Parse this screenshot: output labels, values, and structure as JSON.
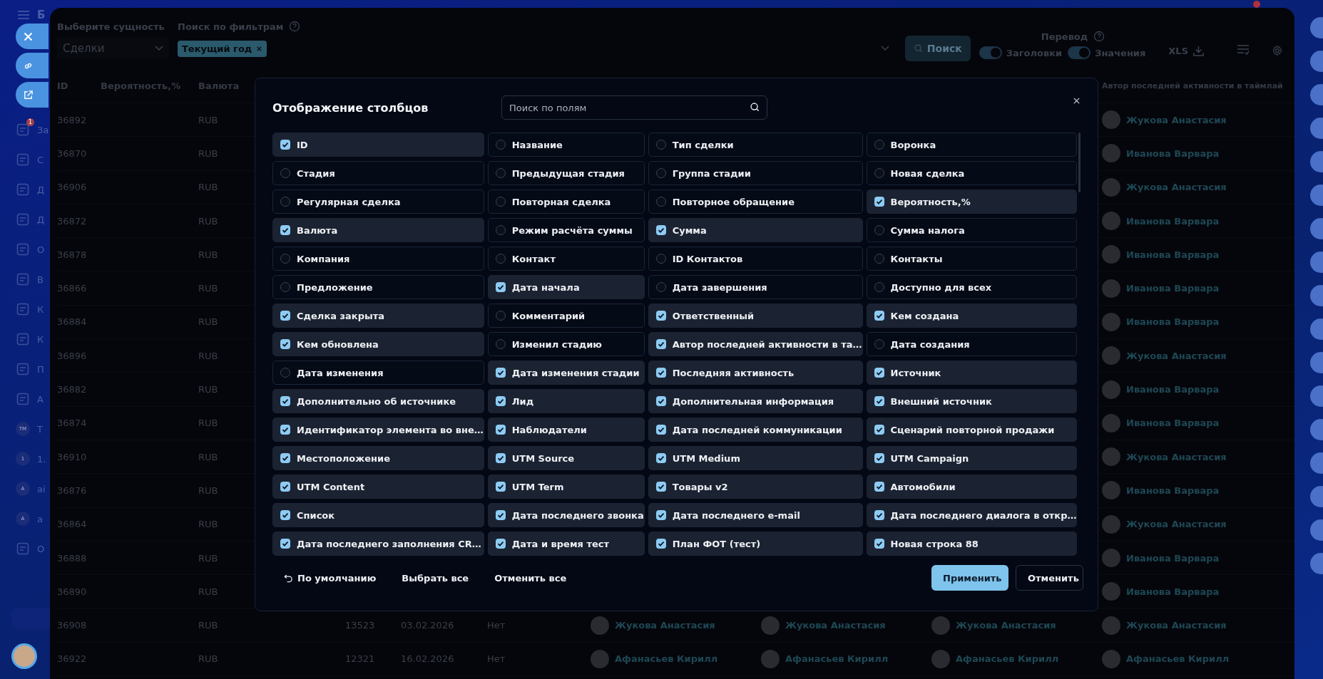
{
  "sidebar": {
    "brand": "Б",
    "items": [
      {
        "kind": "icon",
        "label": "За",
        "badge": "1"
      },
      {
        "kind": "icon",
        "label": "С"
      },
      {
        "kind": "icon",
        "label": "Д"
      },
      {
        "kind": "icon",
        "label": "Д"
      },
      {
        "kind": "icon",
        "label": "О"
      },
      {
        "kind": "icon",
        "label": "В"
      },
      {
        "kind": "icon",
        "label": "К"
      },
      {
        "kind": "icon",
        "label": "К"
      },
      {
        "kind": "icon",
        "label": "П"
      },
      {
        "kind": "icon",
        "label": "А"
      },
      {
        "kind": "circle",
        "initials": "ТМ",
        "label": "Т"
      },
      {
        "kind": "circle",
        "initials": "1",
        "label": "1."
      },
      {
        "kind": "circle",
        "initials": "A",
        "label": "ai"
      },
      {
        "kind": "circle",
        "initials": "A",
        "label": "a"
      },
      {
        "kind": "icon",
        "label": "О"
      }
    ]
  },
  "toolbar": {
    "entity_label": "Выберите сущность",
    "entity_value": "Сделки",
    "filter_label": "Поиск по фильтрам",
    "filter_chips": [
      "Текущий год"
    ],
    "search_button": "Поиск",
    "translation_label": "Перевод",
    "toggles": [
      {
        "label": "Заголовки",
        "on": true
      },
      {
        "label": "Значения",
        "on": true
      }
    ],
    "export_button": "XLS"
  },
  "table": {
    "columns": [
      "ID",
      "Вероятность,%",
      "Валюта",
      "Автор последней активности в таймлай"
    ],
    "rows": [
      {
        "id": "36892",
        "currency": "RUB",
        "author": "Жукова Анастасия"
      },
      {
        "id": "36870",
        "currency": "RUB",
        "author": "Иванова Варвара"
      },
      {
        "id": "36906",
        "currency": "RUB",
        "author": "Жукова Анастасия"
      },
      {
        "id": "36872",
        "currency": "RUB",
        "author": "Иванова Варвара"
      },
      {
        "id": "36878",
        "currency": "RUB",
        "author": "Иванова Варвара"
      },
      {
        "id": "36866",
        "currency": "RUB",
        "author": "Иванова Варвара"
      },
      {
        "id": "36884",
        "currency": "RUB",
        "author": "Иванова Варвара"
      },
      {
        "id": "36896",
        "currency": "RUB",
        "author": "Жукова Анастасия"
      },
      {
        "id": "36882",
        "currency": "RUB",
        "author": "Иванова Варвара"
      },
      {
        "id": "36874",
        "currency": "RUB",
        "author": "Иванова Варвара"
      },
      {
        "id": "36910",
        "currency": "RUB",
        "author": "Жукова Анастасия"
      },
      {
        "id": "36876",
        "currency": "RUB",
        "author": "Иванова Варвара"
      },
      {
        "id": "36864",
        "currency": "RUB",
        "author": "Жукова Анастасия"
      },
      {
        "id": "36888",
        "currency": "RUB",
        "author": "Иванова Варвара"
      },
      {
        "id": "36890",
        "currency": "RUB",
        "author": "Иванова Варвара"
      },
      {
        "id": "36908",
        "currency": "RUB",
        "column_4": "13523",
        "column_5": "03.02.2026",
        "column_6": "Нет",
        "column_7": "Жукова Анастасия",
        "column_8": "Жукова Анастасия",
        "column_9": "Жукова Анастасия",
        "author": "Жукова Анастасия"
      },
      {
        "id": "36922",
        "currency": "RUB",
        "column_4": "12321",
        "column_5": "16.02.2026",
        "column_6": "Нет",
        "column_7": "Афанасьев Кирилл",
        "column_8": "Афанасьев Кирилл",
        "column_9": "Афанасьев Кирилл",
        "author": "Афанасьев Кирилл"
      }
    ]
  },
  "modal": {
    "title": "Отображение столбцов",
    "search_placeholder": "Поиск по полям",
    "fields": [
      {
        "label": "ID",
        "checked": true
      },
      {
        "label": "Название",
        "checked": false
      },
      {
        "label": "Тип сделки",
        "checked": false
      },
      {
        "label": "Воронка",
        "checked": false
      },
      {
        "label": "Стадия",
        "checked": false
      },
      {
        "label": "Предыдущая стадия",
        "checked": false
      },
      {
        "label": "Группа стадии",
        "checked": false
      },
      {
        "label": "Новая сделка",
        "checked": false
      },
      {
        "label": "Регулярная сделка",
        "checked": false
      },
      {
        "label": "Повторная сделка",
        "checked": false
      },
      {
        "label": "Повторное обращение",
        "checked": false
      },
      {
        "label": "Вероятность,%",
        "checked": true
      },
      {
        "label": "Валюта",
        "checked": true
      },
      {
        "label": "Режим расчёта суммы",
        "checked": false
      },
      {
        "label": "Сумма",
        "checked": true
      },
      {
        "label": "Сумма налога",
        "checked": false
      },
      {
        "label": "Компания",
        "checked": false
      },
      {
        "label": "Контакт",
        "checked": false
      },
      {
        "label": "ID Контактов",
        "checked": false
      },
      {
        "label": "Контакты",
        "checked": false
      },
      {
        "label": "Предложение",
        "checked": false
      },
      {
        "label": "Дата начала",
        "checked": true
      },
      {
        "label": "Дата завершения",
        "checked": false
      },
      {
        "label": "Доступно для всех",
        "checked": false
      },
      {
        "label": "Сделка закрыта",
        "checked": true
      },
      {
        "label": "Комментарий",
        "checked": false
      },
      {
        "label": "Ответственный",
        "checked": true
      },
      {
        "label": "Кем создана",
        "checked": true
      },
      {
        "label": "Кем обновлена",
        "checked": true
      },
      {
        "label": "Изменил стадию",
        "checked": false
      },
      {
        "label": "Автор последней активности в та…",
        "checked": true
      },
      {
        "label": "Дата создания",
        "checked": false
      },
      {
        "label": "Дата изменения",
        "checked": false
      },
      {
        "label": "Дата изменения стадии",
        "checked": true
      },
      {
        "label": "Последняя активность",
        "checked": true
      },
      {
        "label": "Источник",
        "checked": true
      },
      {
        "label": "Дополнительно об источнике",
        "checked": true
      },
      {
        "label": "Лид",
        "checked": true
      },
      {
        "label": "Дополнительная информация",
        "checked": true
      },
      {
        "label": "Внешний источник",
        "checked": true
      },
      {
        "label": "Идентификатор элемента во вне…",
        "checked": true
      },
      {
        "label": "Наблюдатели",
        "checked": true
      },
      {
        "label": "Дата последней коммуникации",
        "checked": true
      },
      {
        "label": "Сценарий повторной продажи",
        "checked": true
      },
      {
        "label": "Местоположение",
        "checked": true
      },
      {
        "label": "UTM Source",
        "checked": true
      },
      {
        "label": "UTM Medium",
        "checked": true
      },
      {
        "label": "UTM Campaign",
        "checked": true
      },
      {
        "label": "UTM Content",
        "checked": true
      },
      {
        "label": "UTM Term",
        "checked": true
      },
      {
        "label": "Товары v2",
        "checked": true
      },
      {
        "label": "Автомобили",
        "checked": true
      },
      {
        "label": "Список",
        "checked": true
      },
      {
        "label": "Дата последнего звонка",
        "checked": true
      },
      {
        "label": "Дата последнего e-mail",
        "checked": true
      },
      {
        "label": "Дата последнего диалога в откр…",
        "checked": true
      },
      {
        "label": "Дата последнего заполнения CR…",
        "checked": true
      },
      {
        "label": "Дата и время тест",
        "checked": true
      },
      {
        "label": "План ФОТ (тест)",
        "checked": true
      },
      {
        "label": "Новая строка 88",
        "checked": true
      }
    ],
    "footer_links": [
      "По умолчанию",
      "Выбрать все",
      "Отменить все"
    ],
    "buttons": [
      {
        "label": "Применить",
        "kind": "primary"
      },
      {
        "label": "Отменить",
        "kind": "secondary"
      }
    ]
  }
}
